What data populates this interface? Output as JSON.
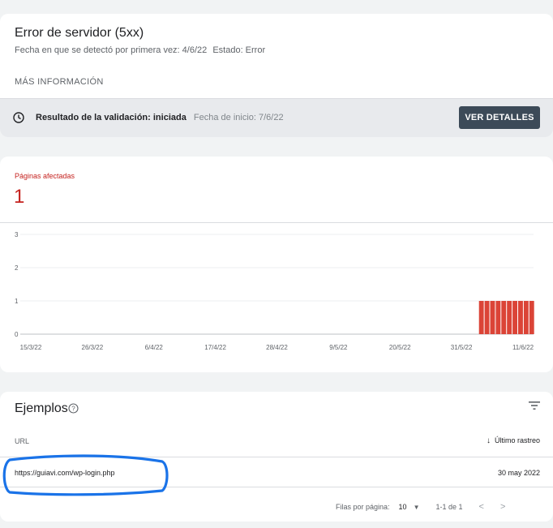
{
  "issue": {
    "title": "Error de servidor (5xx)",
    "first_detected_label": "Fecha en que se detectó por primera vez: 4/6/22",
    "status_label": "Estado: Error",
    "more_info": "MÁS INFORMACIÓN"
  },
  "validation": {
    "icon": "clock-icon",
    "result_label": "Resultado de la validación: iniciada",
    "start_date_label": "Fecha de inicio: 7/6/22",
    "details_button": "VER DETALLES"
  },
  "affected": {
    "label": "Páginas afectadas",
    "count": "1"
  },
  "chart_data": {
    "type": "bar",
    "x_tick_labels": [
      "15/3/22",
      "26/3/22",
      "6/4/22",
      "17/4/22",
      "28/4/22",
      "9/5/22",
      "20/5/22",
      "31/5/22",
      "11/6/22"
    ],
    "y_ticks": [
      0,
      1,
      2,
      3
    ],
    "ylim": [
      0,
      3
    ],
    "bar_color": "#db4437",
    "dates": [
      "4/6/22",
      "5/6/22",
      "6/6/22",
      "7/6/22",
      "8/6/22",
      "9/6/22",
      "10/6/22",
      "11/6/22",
      "12/6/22",
      "13/6/22"
    ],
    "values": [
      1,
      1,
      1,
      1,
      1,
      1,
      1,
      1,
      1,
      1
    ],
    "grid": true
  },
  "examples": {
    "title": "Ejemplos",
    "help_icon": "help-icon",
    "filter_icon": "filter-icon",
    "col_url": "URL",
    "col_last_crawl": "Último rastreo",
    "rows": [
      {
        "url": "https://guiavi.com/wp-login.php",
        "last_crawl": "30 may 2022"
      }
    ],
    "pagination": {
      "rows_per_page_label": "Filas por página:",
      "rows_per_page_value": "10",
      "range": "1-1 de 1"
    }
  },
  "colors": {
    "error_red": "#c5221f",
    "button_dark": "#3c4a58",
    "annotation_blue": "#1a73e8"
  }
}
